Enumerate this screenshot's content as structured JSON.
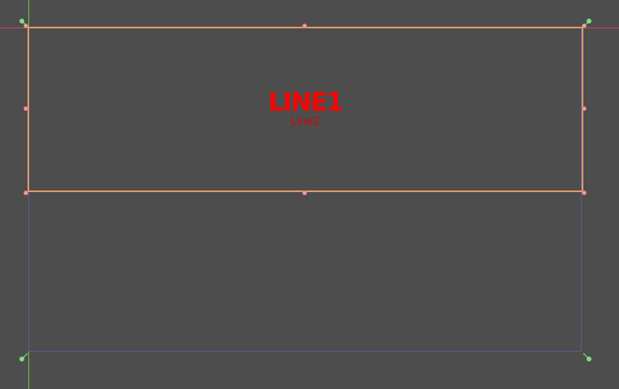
{
  "label": {
    "line1": "LINE1",
    "line2": "Line2"
  },
  "colors": {
    "background": "#4d4d4d",
    "selection_outline": "#e39a6c",
    "parent_outline": "#5b5b8f",
    "guide_vertical": "#7fbf4a",
    "guide_horizontal": "#c94a55",
    "text": "#ff0000",
    "handle": "#f0a0a0",
    "anchor": "#7fe07f"
  },
  "icons": {
    "resize_handle": "resize-handle-icon",
    "anchor": "anchor-pin-icon"
  }
}
